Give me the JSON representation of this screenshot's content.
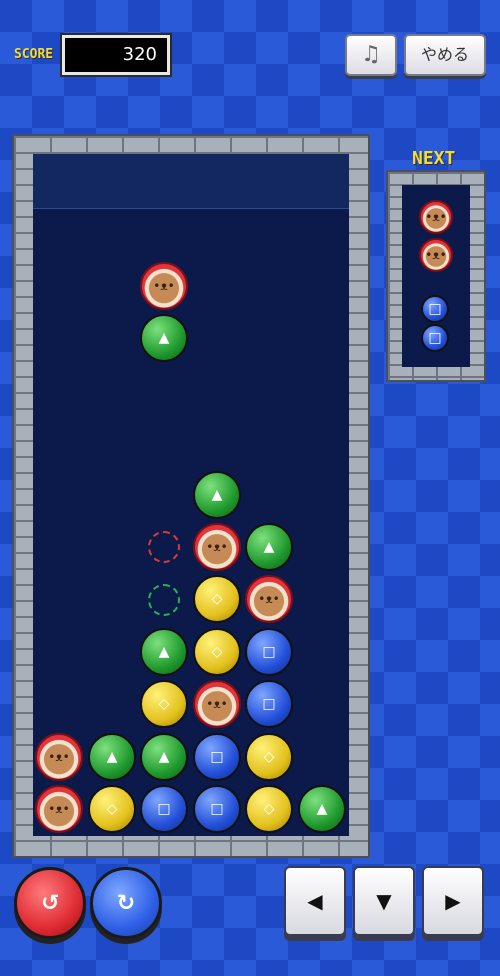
{
  "header": {
    "score_label": "SCORE",
    "score_value": "320",
    "music_icon_glyph": "♫",
    "quit_label": "やめる"
  },
  "next": {
    "label": "NEXT",
    "pairs": [
      [
        "bear",
        "bear"
      ],
      [
        "blue",
        "blue"
      ]
    ]
  },
  "board": {
    "falling_pair": [
      "bear",
      "green"
    ],
    "pieces": [
      "green",
      "bear",
      "green",
      "yellow",
      "bear",
      "green",
      "yellow",
      "blue",
      "yellow",
      "bear",
      "blue",
      "bear",
      "green",
      "green",
      "blue",
      "yellow",
      "bear",
      "yellow",
      "blue",
      "blue",
      "yellow",
      "green"
    ],
    "ghosts": [
      "red",
      "green"
    ]
  },
  "controls": {
    "rotate_left_glyph": "↻",
    "rotate_right_glyph": "↻",
    "left_glyph": "◀",
    "down_glyph": "▼",
    "right_glyph": "▶"
  },
  "colors": {
    "background": "#1d49c4",
    "field": "#0b1a4a",
    "score_text": "#f3dc3a"
  }
}
